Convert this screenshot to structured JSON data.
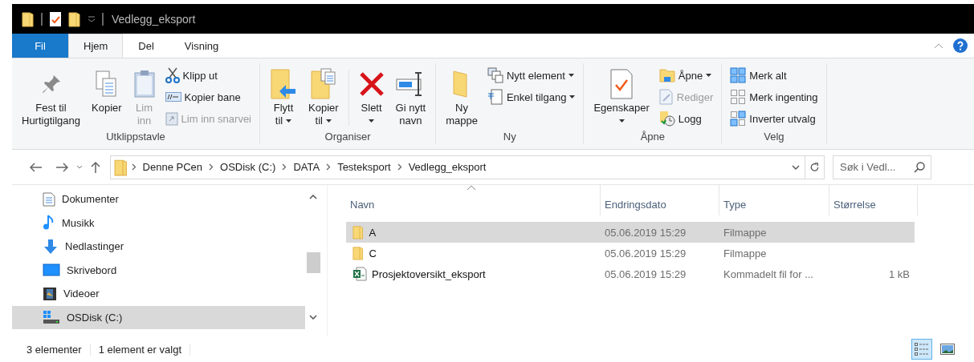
{
  "window": {
    "title": "Vedlegg_eksport"
  },
  "ribbon": {
    "tabs": [
      {
        "label": "Fil",
        "kind": "file",
        "selected": false
      },
      {
        "label": "Hjem",
        "kind": "tab",
        "selected": true
      },
      {
        "label": "Del",
        "kind": "tab",
        "selected": false
      },
      {
        "label": "Visning",
        "kind": "tab",
        "selected": false
      }
    ],
    "groups": [
      {
        "label": "Utklippstavle",
        "items": [
          {
            "kind": "large",
            "lines": [
              "Fest til",
              "Hurtigtilgang"
            ],
            "dropdown": false,
            "disabled": false
          },
          {
            "kind": "large",
            "lines": [
              "Kopier"
            ],
            "dropdown": false,
            "disabled": false
          },
          {
            "kind": "large",
            "lines": [
              "Lim",
              "inn"
            ],
            "dropdown": false,
            "disabled": true
          },
          {
            "kind": "small",
            "lines": [
              "Klipp ut"
            ],
            "dropdown": false,
            "disabled": false
          },
          {
            "kind": "small",
            "lines": [
              "Kopier bane"
            ],
            "dropdown": false,
            "disabled": false
          },
          {
            "kind": "small",
            "lines": [
              "Lim inn snarvei"
            ],
            "dropdown": false,
            "disabled": true
          }
        ]
      },
      {
        "label": "Organiser",
        "items": [
          {
            "kind": "large",
            "lines": [
              "Flytt",
              "til"
            ],
            "dropdown": true,
            "disabled": false
          },
          {
            "kind": "large",
            "lines": [
              "Kopier",
              "til"
            ],
            "dropdown": true,
            "disabled": false
          },
          {
            "kind": "separator"
          },
          {
            "kind": "large",
            "lines": [
              "Slett"
            ],
            "dropdown": true,
            "disabled": false
          },
          {
            "kind": "large",
            "lines": [
              "Gi nytt",
              "navn"
            ],
            "dropdown": false,
            "disabled": false
          }
        ]
      },
      {
        "label": "Ny",
        "items": [
          {
            "kind": "large",
            "lines": [
              "Ny",
              "mappe"
            ],
            "dropdown": false,
            "disabled": false
          },
          {
            "kind": "small",
            "lines": [
              "Nytt element"
            ],
            "dropdown": true,
            "disabled": false
          },
          {
            "kind": "small",
            "lines": [
              "Enkel tilgang"
            ],
            "dropdown": true,
            "disabled": false
          }
        ]
      },
      {
        "label": "Åpne",
        "items": [
          {
            "kind": "large",
            "lines": [
              "Egenskaper"
            ],
            "dropdown": true,
            "disabled": false
          },
          {
            "kind": "small",
            "lines": [
              "Åpne"
            ],
            "dropdown": true,
            "disabled": false
          },
          {
            "kind": "small",
            "lines": [
              "Rediger"
            ],
            "dropdown": false,
            "disabled": true
          },
          {
            "kind": "small",
            "lines": [
              "Logg"
            ],
            "dropdown": false,
            "disabled": false
          }
        ]
      },
      {
        "label": "Velg",
        "items": [
          {
            "kind": "small",
            "lines": [
              "Merk alt"
            ],
            "dropdown": false,
            "disabled": false
          },
          {
            "kind": "small",
            "lines": [
              "Merk ingenting"
            ],
            "dropdown": false,
            "disabled": false
          },
          {
            "kind": "small",
            "lines": [
              "Inverter utvalg"
            ],
            "dropdown": false,
            "disabled": false
          }
        ]
      }
    ]
  },
  "address_bar": {
    "path": [
      "Denne PCen",
      "OSDisk (C:)",
      "DATA",
      "Testeksport",
      "Vedlegg_eksport"
    ],
    "search": {
      "placeholder": "Søk i Vedl..."
    }
  },
  "navigation": {
    "items": [
      {
        "label": "Dokumenter",
        "selected": false
      },
      {
        "label": "Musikk",
        "selected": false
      },
      {
        "label": "Nedlastinger",
        "selected": false
      },
      {
        "label": "Skrivebord",
        "selected": false
      },
      {
        "label": "Videoer",
        "selected": false
      },
      {
        "label": "OSDisk (C:)",
        "selected": true
      }
    ]
  },
  "file_list": {
    "columns": [
      "Navn",
      "Endringsdato",
      "Type",
      "Størrelse"
    ],
    "rows": [
      {
        "kind": "folder",
        "name": "A",
        "date": "05.06.2019 15:29",
        "type": "Filmappe",
        "selected": true
      },
      {
        "kind": "folder",
        "name": "C",
        "date": "05.06.2019 15:29",
        "type": "Filmappe",
        "selected": false
      },
      {
        "kind": "file",
        "name": "Prosjektoversikt_eksport",
        "date": "05.06.2019 15:29",
        "type": "Kommadelt fil for ...",
        "size": "1 kB",
        "selected": false
      }
    ]
  },
  "status_bar": {
    "items": [
      "3 elementer",
      "1 element er valgt"
    ],
    "views": [
      {
        "selected": true
      },
      {
        "selected": false
      }
    ]
  }
}
